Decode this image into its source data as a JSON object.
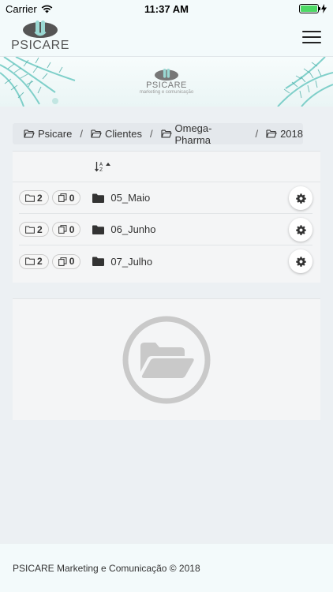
{
  "status_bar": {
    "carrier": "Carrier",
    "time": "11:37 AM"
  },
  "brand": {
    "logo_text": "PSICARE",
    "banner_subtitle": "marketing e comunicação"
  },
  "breadcrumb": [
    {
      "label": "Psicare"
    },
    {
      "label": "Clientes"
    },
    {
      "label": "Omega-Pharma"
    },
    {
      "label": "2018"
    }
  ],
  "breadcrumb_separator": "/",
  "folders": [
    {
      "name": "05_Maio",
      "folder_count": "2",
      "file_count": "0"
    },
    {
      "name": "06_Junho",
      "folder_count": "2",
      "file_count": "0"
    },
    {
      "name": "07_Julho",
      "folder_count": "2",
      "file_count": "0"
    }
  ],
  "footer": {
    "text": "PSICARE Marketing e Comunicação © 2018"
  },
  "colors": {
    "accent_gray": "#c9c9c9",
    "battery_green": "#4cd964",
    "header_bg": "#f3fafb",
    "page_bg": "#ecf0f3"
  }
}
